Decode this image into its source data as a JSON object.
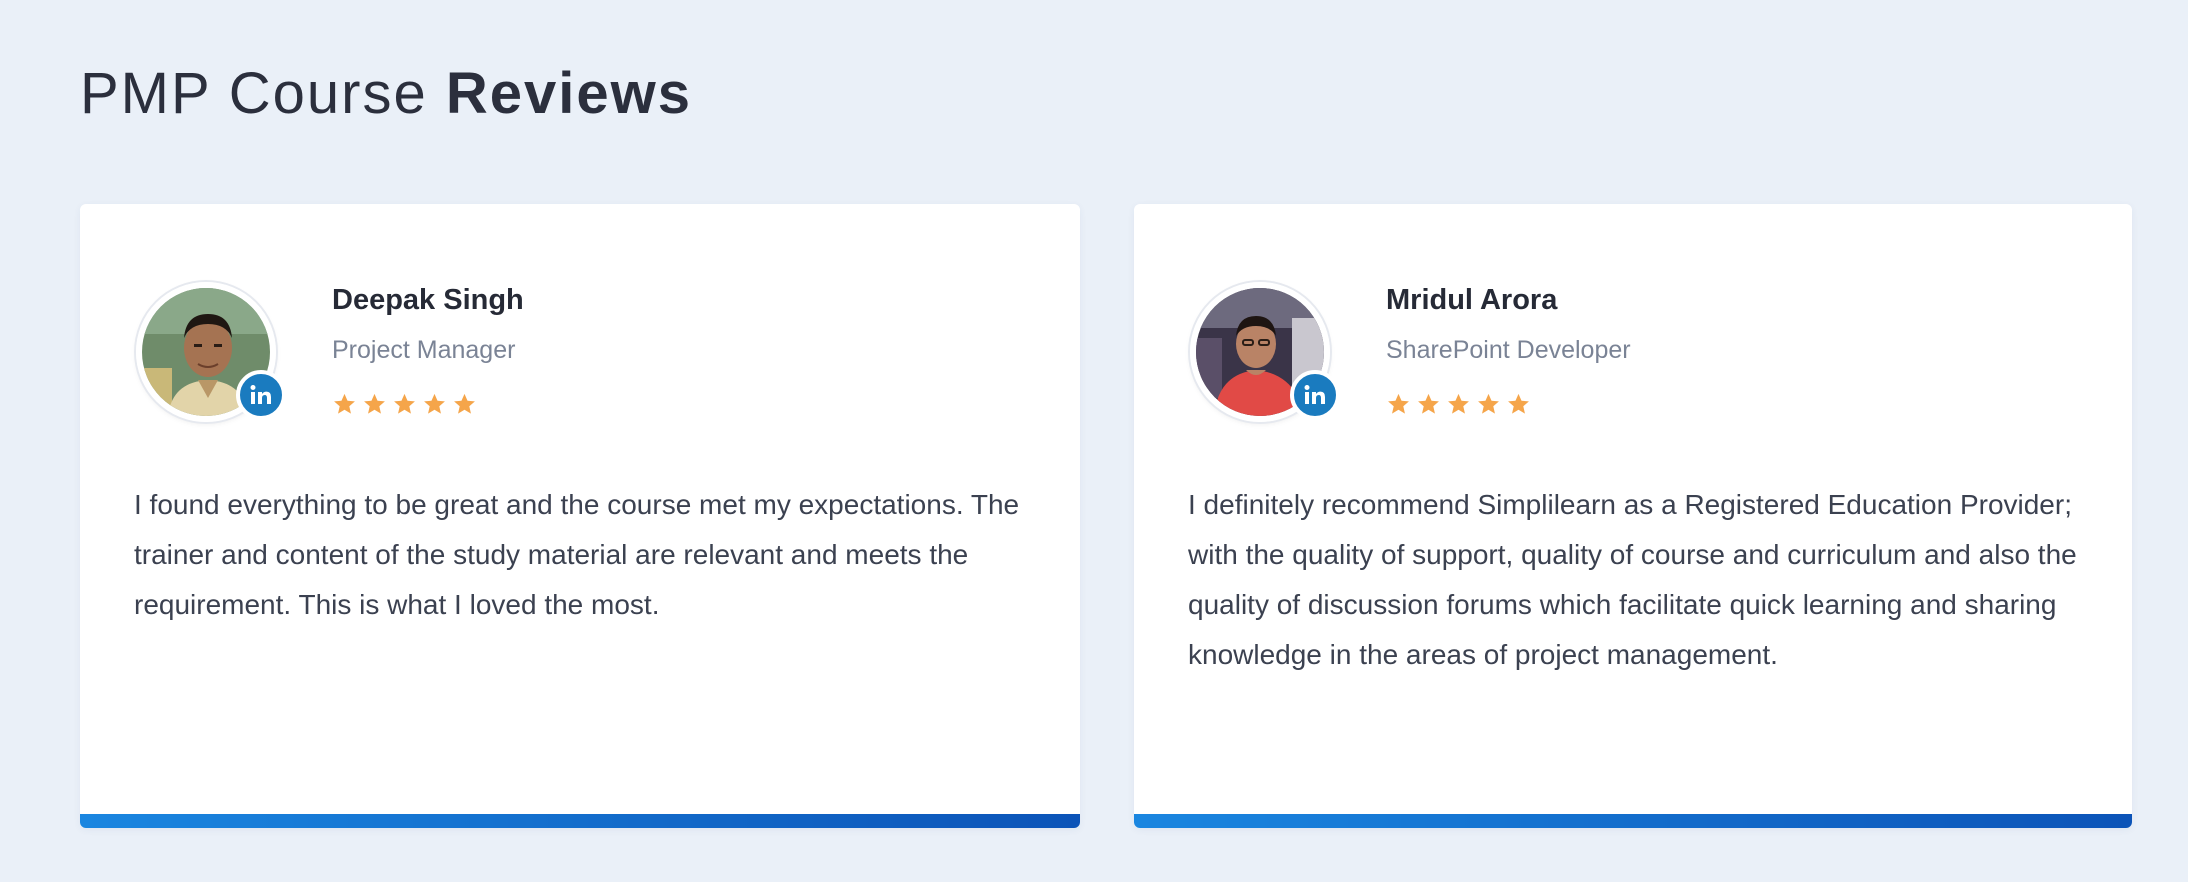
{
  "page": {
    "title_regular": "PMP Course",
    "title_bold": "Reviews"
  },
  "colors": {
    "background": "#eaf0f8",
    "card": "#ffffff",
    "accent_start": "#1a86e0",
    "accent_end": "#0c54b8",
    "star": "#f5a54a",
    "linkedin": "#1a7bbf"
  },
  "reviews": [
    {
      "name": "Deepak Singh",
      "role": "Project Manager",
      "rating": 5,
      "social_icon": "linkedin-icon",
      "linkedin_text": "in",
      "text": "I found everything to be great and the course met my expectations. The trainer and content of the study material are relevant and meets the requirement. This is what I loved the most."
    },
    {
      "name": "Mridul Arora",
      "role": "SharePoint Developer",
      "rating": 5,
      "social_icon": "linkedin-icon",
      "linkedin_text": "in",
      "text": "I definitely recommend Simplilearn as a Registered Education Provider; with the quality of support, quality of course and curriculum and also the quality of discussion forums which facilitate quick learning and sharing knowledge in the areas of project management."
    }
  ]
}
